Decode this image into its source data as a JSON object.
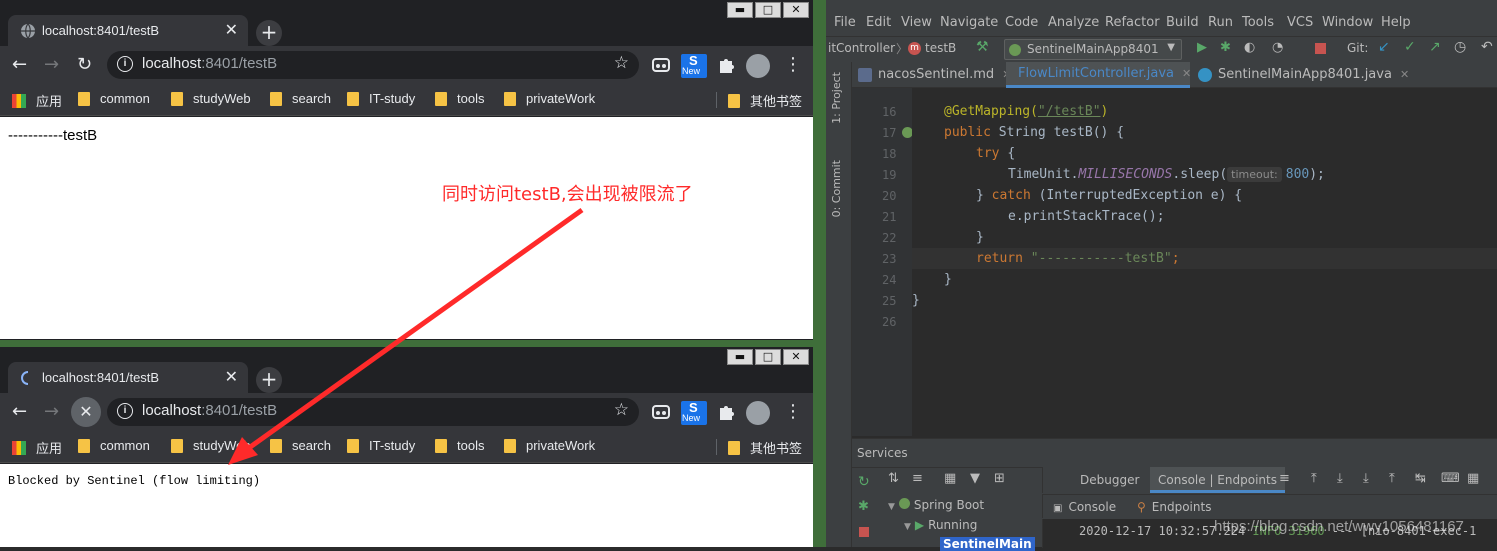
{
  "top_browser": {
    "tab_title": "localhost:8401/testB",
    "url_host": "localhost",
    "url_rest": ":8401/testB",
    "page_text": "-----------testB",
    "new_badge": "New"
  },
  "bottom_browser": {
    "tab_title": "localhost:8401/testB",
    "url_host": "localhost",
    "url_rest": ":8401/testB",
    "page_text": "Blocked by Sentinel (flow limiting)",
    "new_badge": "New"
  },
  "bookmarks": [
    "应用",
    "common",
    "studyWeb",
    "search",
    "IT-study",
    "tools",
    "privateWork",
    "其他书签"
  ],
  "window_buttons": {
    "minimize": "▬",
    "maximize": "□",
    "close": "✕"
  },
  "annotation": {
    "text": "同时访问testB,会出现被限流了",
    "color": "#ff2a2a"
  },
  "ide": {
    "menu": [
      "File",
      "Edit",
      "View",
      "Navigate",
      "Code",
      "Analyze",
      "Refactor",
      "Build",
      "Run",
      "Tools",
      "VCS",
      "Window",
      "Help"
    ],
    "breadcrumb_controller": "itController",
    "breadcrumb_method": "testB",
    "run_config": "SentinelMainApp8401",
    "git_label": "Git:",
    "file_tabs": [
      "nacosSentinel.md",
      "FlowLimitController.java",
      "SentinelMainApp8401.java"
    ],
    "side_labels": [
      "1: Project",
      "0: Commit"
    ],
    "line_numbers": [
      "16",
      "17",
      "18",
      "19",
      "20",
      "21",
      "22",
      "23",
      "24",
      "25",
      "26"
    ],
    "code": {
      "l16_ann": "@GetMapping(",
      "l16_str": "\"/testB\"",
      "l16_end": ")",
      "l17_kw": "public ",
      "l17_rest": "String testB() {",
      "l18_kw": "try ",
      "l18_rest": "{",
      "l19_a": "TimeUnit.",
      "l19_fld": "MILLISECONDS",
      "l19_b": ".sleep(",
      "l19_hint": "timeout:",
      "l19_num": "800",
      "l19_end": ");",
      "l20_a": "} ",
      "l20_kw": "catch ",
      "l20_b": "(InterruptedException e) {",
      "l21": "e.printStackTrace();",
      "l22": "}",
      "l23_kw": "return ",
      "l23_str": "\"-----------testB\"",
      "l23_end": ";",
      "l24": "}",
      "l25": "}"
    },
    "services": {
      "title": "Services",
      "tab_debugger": "Debugger",
      "tab_console": "Console | Endpoints",
      "sub_console": "Console",
      "sub_endpoints": "Endpoints",
      "tree_spring": "Spring Boot",
      "tree_running": "Running",
      "tree_app": "SentinelMain",
      "log_time": "2020-12-17 10:32:57.224",
      "log_level": "INFO 31960",
      "log_thread": "[nio-8401-exec-1"
    }
  },
  "watermark": "https://blog.csdn.net/wwy1056481167"
}
